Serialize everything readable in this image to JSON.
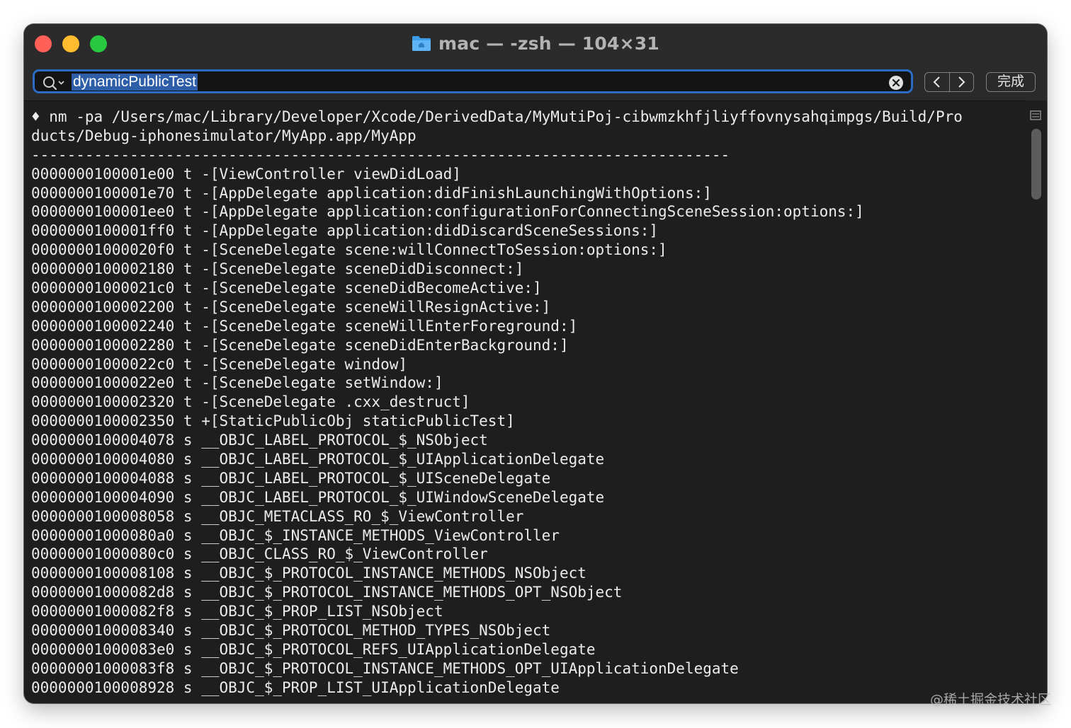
{
  "window": {
    "title": "mac — -zsh — 104×31",
    "title_icon": "folder-home-icon"
  },
  "findbar": {
    "query": "dynamicPublicTest",
    "done_label": "完成"
  },
  "terminal": {
    "lines": [
      "♦ nm -pa /Users/mac/Library/Developer/Xcode/DerivedData/MyMutiPoj-cibwmzkhfjliyffovnysahqimpgs/Build/Pro",
      "ducts/Debug-iphonesimulator/MyApp.app/MyApp",
      "------------------------------------------------------------------------------",
      "0000000100001e00 t -[ViewController viewDidLoad]",
      "0000000100001e70 t -[AppDelegate application:didFinishLaunchingWithOptions:]",
      "0000000100001ee0 t -[AppDelegate application:configurationForConnectingSceneSession:options:]",
      "0000000100001ff0 t -[AppDelegate application:didDiscardSceneSessions:]",
      "00000001000020f0 t -[SceneDelegate scene:willConnectToSession:options:]",
      "0000000100002180 t -[SceneDelegate sceneDidDisconnect:]",
      "00000001000021c0 t -[SceneDelegate sceneDidBecomeActive:]",
      "0000000100002200 t -[SceneDelegate sceneWillResignActive:]",
      "0000000100002240 t -[SceneDelegate sceneWillEnterForeground:]",
      "0000000100002280 t -[SceneDelegate sceneDidEnterBackground:]",
      "00000001000022c0 t -[SceneDelegate window]",
      "00000001000022e0 t -[SceneDelegate setWindow:]",
      "0000000100002320 t -[SceneDelegate .cxx_destruct]",
      "0000000100002350 t +[StaticPublicObj staticPublicTest]",
      "0000000100004078 s __OBJC_LABEL_PROTOCOL_$_NSObject",
      "0000000100004080 s __OBJC_LABEL_PROTOCOL_$_UIApplicationDelegate",
      "0000000100004088 s __OBJC_LABEL_PROTOCOL_$_UISceneDelegate",
      "0000000100004090 s __OBJC_LABEL_PROTOCOL_$_UIWindowSceneDelegate",
      "0000000100008058 s __OBJC_METACLASS_RO_$_ViewController",
      "00000001000080a0 s __OBJC_$_INSTANCE_METHODS_ViewController",
      "00000001000080c0 s __OBJC_CLASS_RO_$_ViewController",
      "0000000100008108 s __OBJC_$_PROTOCOL_INSTANCE_METHODS_NSObject",
      "00000001000082d8 s __OBJC_$_PROTOCOL_INSTANCE_METHODS_OPT_NSObject",
      "00000001000082f8 s __OBJC_$_PROP_LIST_NSObject",
      "0000000100008340 s __OBJC_$_PROTOCOL_METHOD_TYPES_NSObject",
      "00000001000083e0 s __OBJC_$_PROTOCOL_REFS_UIApplicationDelegate",
      "00000001000083f8 s __OBJC_$_PROTOCOL_INSTANCE_METHODS_OPT_UIApplicationDelegate",
      "0000000100008928 s __OBJC_$_PROP_LIST_UIApplicationDelegate"
    ]
  },
  "watermark": "@稀土掘金技术社区",
  "colors": {
    "terminal_bg": "#1e1e1e",
    "titlebar_bg": "#2c2b2b",
    "search_focus": "#2b6cc4",
    "selection": "#2e5ea8"
  }
}
